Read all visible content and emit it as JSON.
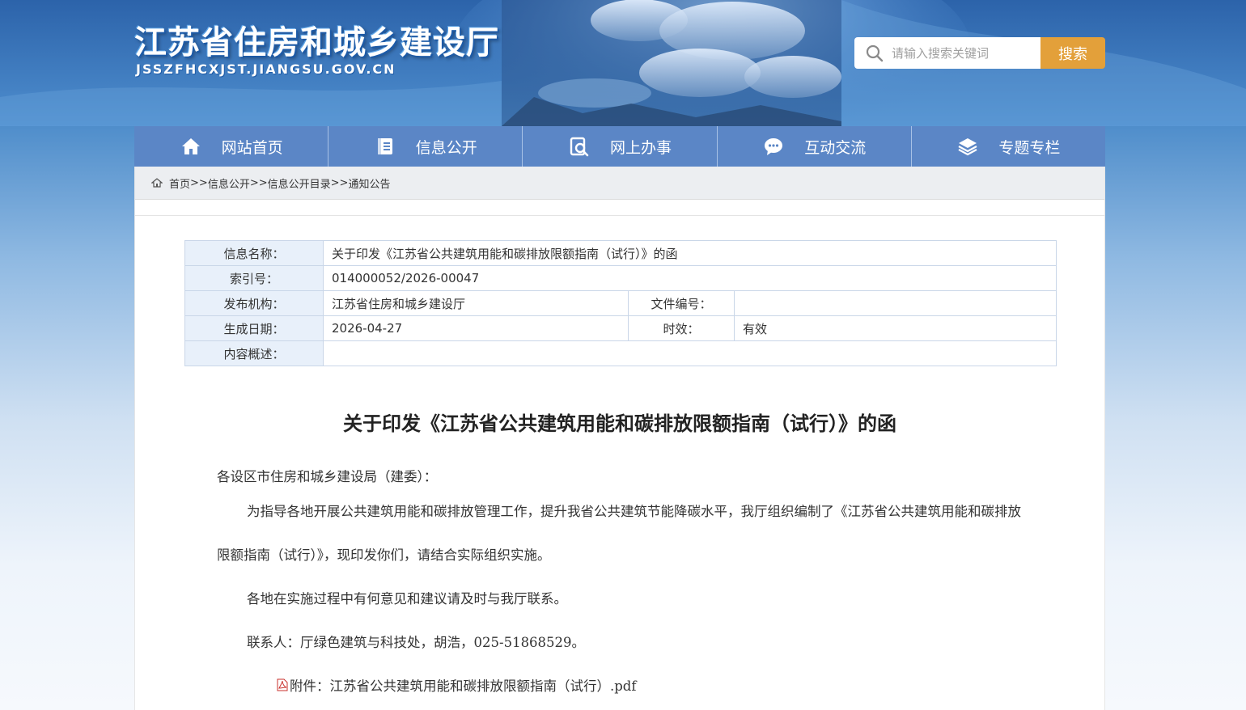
{
  "header": {
    "site_title": "江苏省住房和城乡建设厅",
    "site_domain": "JSSZFHCXJST.JIANGSU.GOV.CN",
    "search_placeholder": "请输入搜索关键词",
    "search_button": "搜索"
  },
  "nav": [
    {
      "label": "网站首页",
      "icon": "home-icon"
    },
    {
      "label": "信息公开",
      "icon": "document-icon"
    },
    {
      "label": "网上办事",
      "icon": "search-document-icon"
    },
    {
      "label": "互动交流",
      "icon": "chat-icon"
    },
    {
      "label": "专题专栏",
      "icon": "layers-icon"
    }
  ],
  "breadcrumb": {
    "items": [
      "首页",
      "信息公开",
      "信息公开目录",
      "通知公告"
    ],
    "separator": ">>"
  },
  "info": {
    "name_label": "信息名称：",
    "name_value": "关于印发《江苏省公共建筑用能和碳排放限额指南（试行）》的函",
    "index_label": "索引号：",
    "index_value": "014000052/2026-00047",
    "org_label": "发布机构：",
    "org_value": "江苏省住房和城乡建设厅",
    "docno_label": "文件编号：",
    "docno_value": "",
    "date_label": "生成日期：",
    "date_value": "2026-04-27",
    "validity_label": "时效：",
    "validity_value": "有效",
    "summary_label": "内容概述：",
    "summary_value": ""
  },
  "article": {
    "title": "关于印发《江苏省公共建筑用能和碳排放限额指南（试行）》的函",
    "salutation": "各设区市住房和城乡建设局（建委）：",
    "p1": "为指导各地开展公共建筑用能和碳排放管理工作，提升我省公共建筑节能降碳水平，我厅组织编制了《江苏省公共建筑用能和碳排放限额指南（试行）》，现印发你们，请结合实际组织实施。",
    "p2": "各地在实施过程中有何意见和建议请及时与我厅联系。",
    "p3": "联系人：厅绿色建筑与科技处，胡浩，025-51868529。",
    "attachment": "附件：江苏省公共建筑用能和碳排放限额指南（试行）.pdf",
    "attachment_icon": "pdf-icon"
  },
  "colors": {
    "nav_bg": "#5b86c6",
    "search_button": "#e3a03a",
    "table_label_bg": "#e8f0fa"
  }
}
